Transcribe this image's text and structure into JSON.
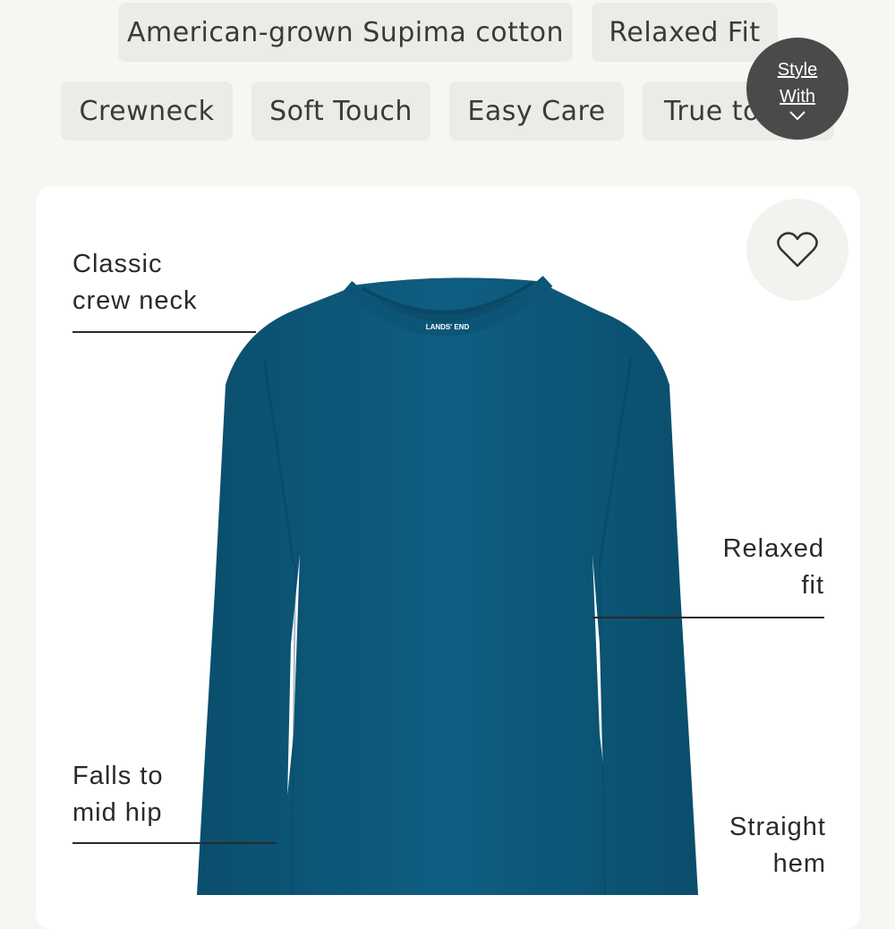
{
  "feature_chips": [
    "American-grown Supima cotton",
    "Relaxed Fit",
    "Crewneck",
    "Soft Touch",
    "Easy Care",
    "True to"
  ],
  "style_with": {
    "line1": "Style",
    "line2": "With"
  },
  "product_image": {
    "brand_label": "LANDS' END",
    "color": "#0e5a7c"
  },
  "callouts": {
    "classic_crew_neck": [
      "Classic",
      "crew neck"
    ],
    "relaxed_fit": [
      "Relaxed",
      "fit"
    ],
    "falls_to_mid_hip": [
      "Falls to",
      "mid hip"
    ],
    "straight_hem": [
      "Straight",
      "hem"
    ]
  },
  "icons": {
    "favorite": "heart-icon",
    "expand": "chevron-down-icon"
  }
}
